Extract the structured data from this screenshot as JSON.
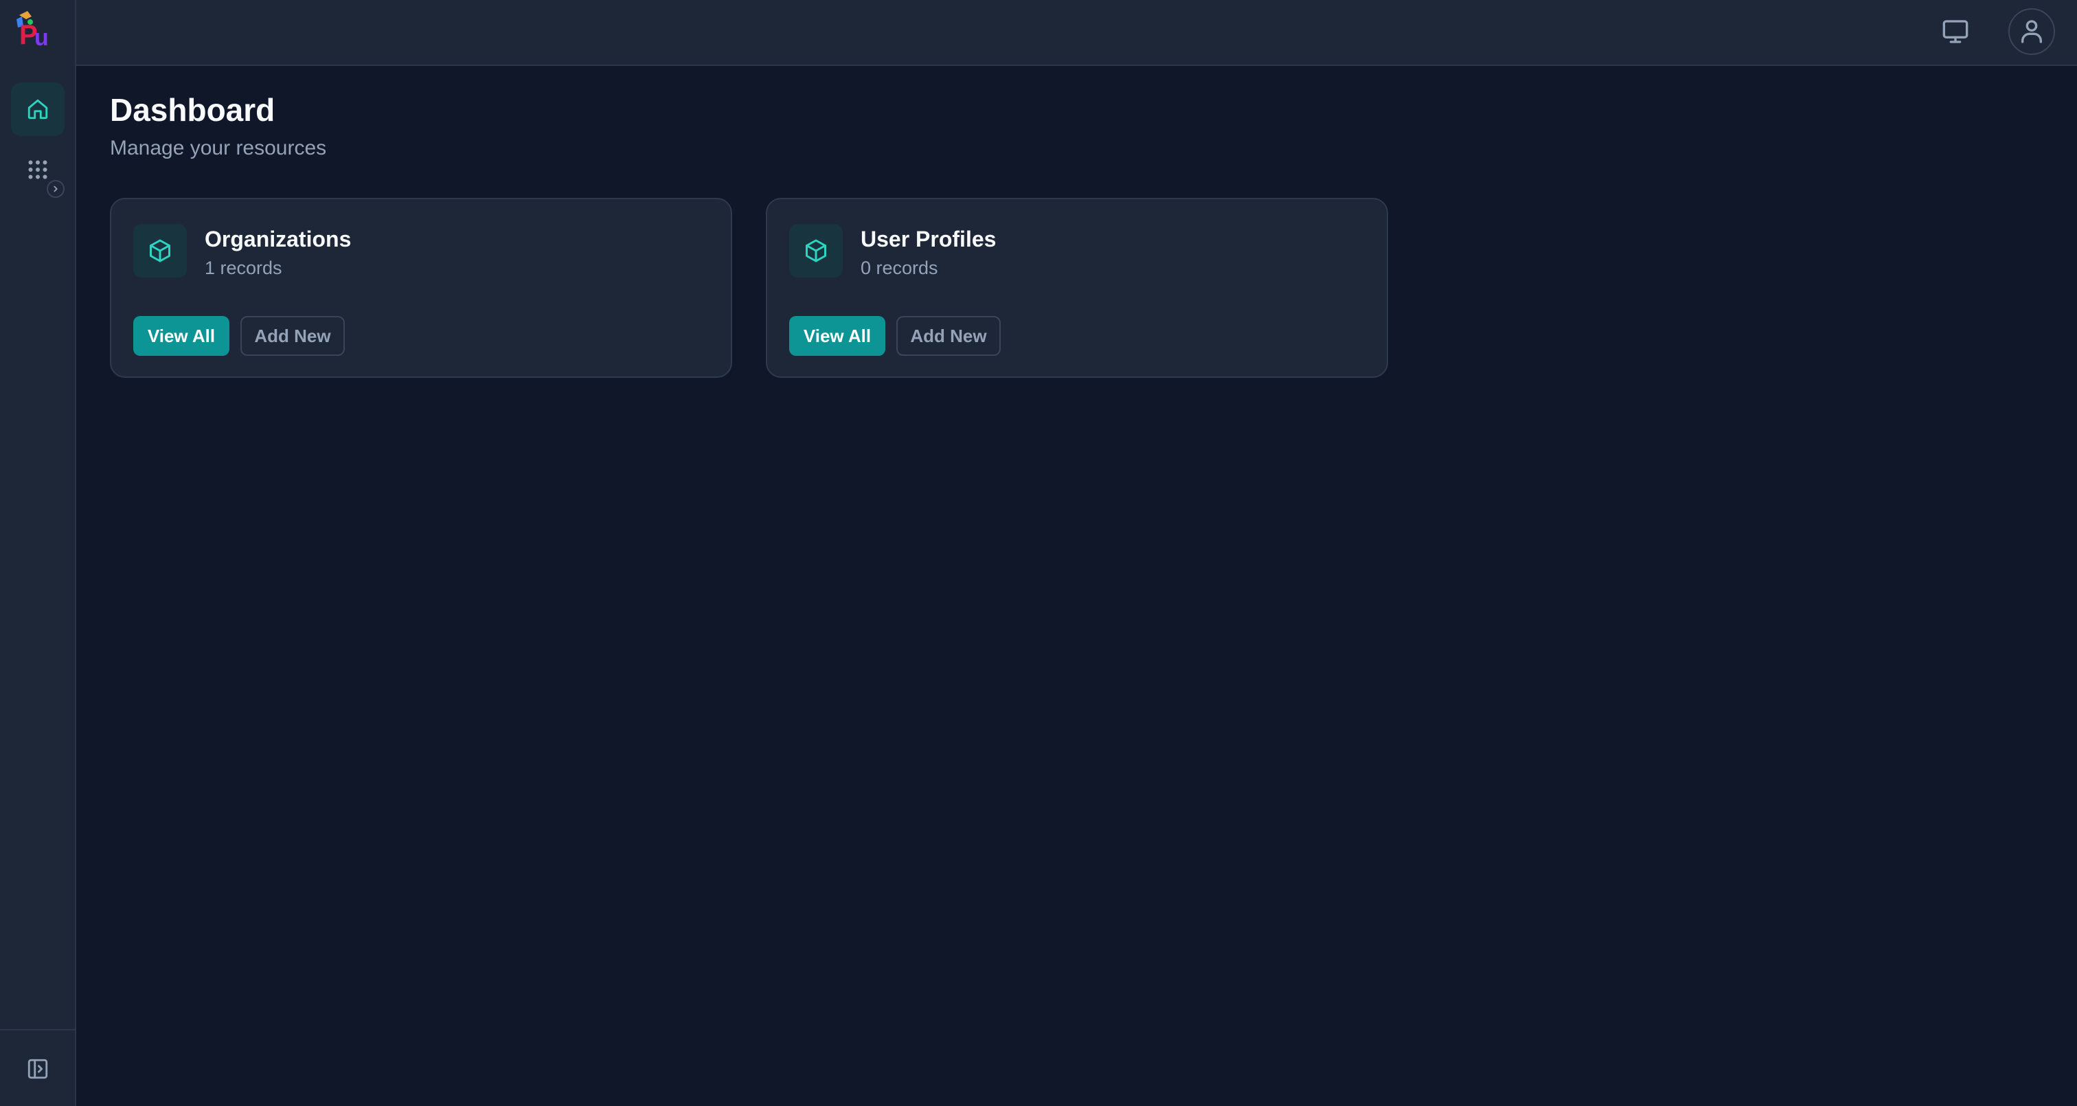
{
  "sidebar": {
    "logo_name": "app-logo",
    "items": [
      {
        "name": "home",
        "icon": "home-icon",
        "active": true
      },
      {
        "name": "apps",
        "icon": "grid-icon",
        "active": false
      }
    ],
    "collapse_icon": "sidebar-toggle-icon"
  },
  "topbar": {
    "monitor_icon": "monitor-icon",
    "user_icon": "user-icon"
  },
  "page": {
    "title": "Dashboard",
    "subtitle": "Manage your resources"
  },
  "cards": [
    {
      "title": "Organizations",
      "count_label": "1 records",
      "icon": "cube-icon",
      "primary_label": "View All",
      "secondary_label": "Add New"
    },
    {
      "title": "User Profiles",
      "count_label": "0 records",
      "icon": "cube-icon",
      "primary_label": "View All",
      "secondary_label": "Add New"
    }
  ],
  "colors": {
    "background": "#0f1729",
    "surface": "#1e2738",
    "accent": "#0d9494",
    "icon_accent": "#2dd4bf",
    "muted_text": "#94a3b8"
  }
}
